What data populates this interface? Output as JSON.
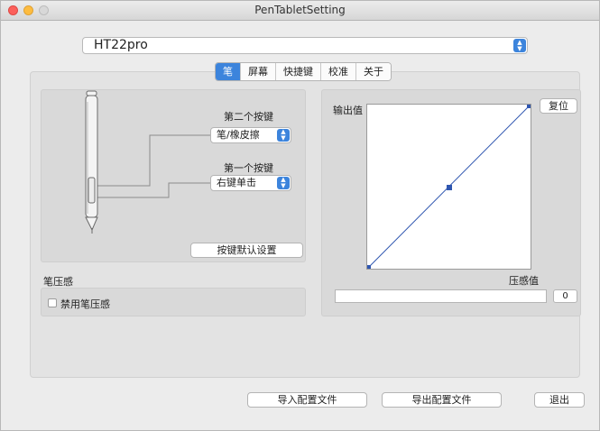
{
  "window": {
    "title": "PenTabletSetting"
  },
  "device": {
    "selected": "HT22pro"
  },
  "tabs": [
    {
      "label": "笔",
      "active": true
    },
    {
      "label": "屏幕",
      "active": false
    },
    {
      "label": "快捷键",
      "active": false
    },
    {
      "label": "校准",
      "active": false
    },
    {
      "label": "关于",
      "active": false
    }
  ],
  "pen": {
    "second_button_label": "第二个按键",
    "second_button_value": "笔/橡皮擦",
    "first_button_label": "第一个按键",
    "first_button_value": "右键单击",
    "default_button_label": "按键默认设置"
  },
  "pressure": {
    "section_label": "笔压感",
    "disable_label": "禁用笔压感",
    "disable_checked": false
  },
  "curve": {
    "output_label": "输出值",
    "input_label": "压感值",
    "reset_label": "复位",
    "value": "0",
    "accent_color": "#2f56b0"
  },
  "footer": {
    "import_label": "导入配置文件",
    "export_label": "导出配置文件",
    "exit_label": "退出"
  }
}
